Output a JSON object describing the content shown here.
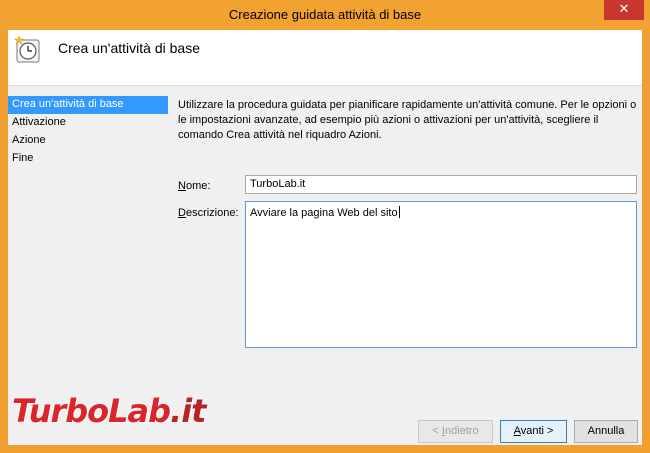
{
  "window": {
    "title": "Creazione guidata attività di base",
    "close_glyph": "✕"
  },
  "header": {
    "title": "Crea un'attività di base",
    "icon": "task-scheduler-clock-icon"
  },
  "nav": {
    "items": [
      {
        "label": "Crea un'attività di base",
        "active": true
      },
      {
        "label": "Attivazione",
        "active": false
      },
      {
        "label": "Azione",
        "active": false
      },
      {
        "label": "Fine",
        "active": false
      }
    ]
  },
  "main": {
    "description_lines": [
      "Utilizzare la procedura guidata per pianificare rapidamente un'attività comune. Per le opzioni o",
      "le impostazioni avanzate, ad esempio più azioni o attivazioni per un'attività, scegliere il",
      "comando Crea attività nel riquadro Azioni."
    ],
    "name_label_accel": "N",
    "name_label_rest": "ome:",
    "name_value": "TurboLab.it",
    "desc_label_accel": "D",
    "desc_label_rest": "escrizione:",
    "desc_value": "Avviare la pagina Web del sito"
  },
  "buttons": {
    "back_prefix": "< ",
    "back_accel": "I",
    "back_rest": "ndietro",
    "next_accel": "A",
    "next_rest": "vanti >",
    "cancel": "Annulla"
  },
  "watermark": {
    "part1": "TurboLab",
    "part2": ".it"
  },
  "colors": {
    "titlebar": "#f2a231",
    "close": "#c7372f",
    "selection": "#3399ff",
    "watermark": "#d9141b"
  }
}
